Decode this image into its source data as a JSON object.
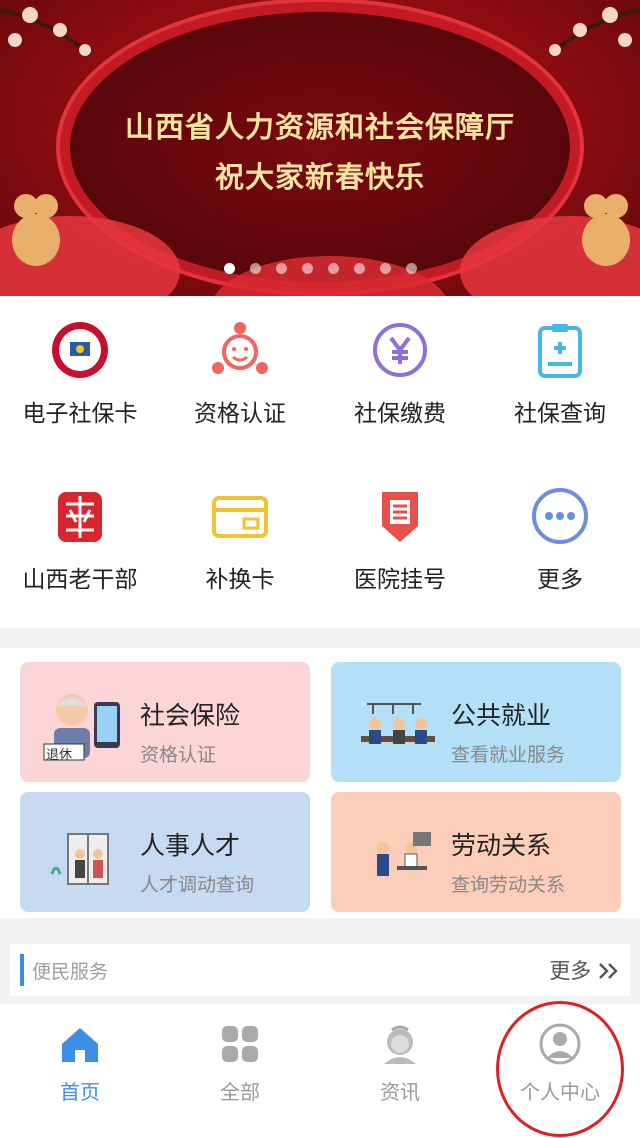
{
  "banner": {
    "line1": "山西省人力资源和社会保障厅",
    "line2": "祝大家新春快乐",
    "dot_count": 8,
    "active_dot": 0
  },
  "grid": [
    {
      "label": "电子社保卡",
      "icon": "social-security-card-icon"
    },
    {
      "label": "资格认证",
      "icon": "face-verification-icon"
    },
    {
      "label": "社保缴费",
      "icon": "yuan-payment-icon"
    },
    {
      "label": "社保查询",
      "icon": "clipboard-query-icon"
    },
    {
      "label": "山西老干部",
      "icon": "veteran-cadre-icon"
    },
    {
      "label": "补换卡",
      "icon": "card-replace-icon"
    },
    {
      "label": "医院挂号",
      "icon": "hospital-register-icon"
    },
    {
      "label": "更多",
      "icon": "more-dots-icon"
    }
  ],
  "cards": [
    {
      "title": "社会保险",
      "subtitle": "资格认证",
      "tag": "退休",
      "bg": "#fcd5d9"
    },
    {
      "title": "公共就业",
      "subtitle": "查看就业服务",
      "bg": "#b3e0f7"
    },
    {
      "title": "人事人才",
      "subtitle": "人才调动查询",
      "bg": "#c6dbf2"
    },
    {
      "title": "劳动关系",
      "subtitle": "查询劳动关系",
      "bg": "#fccdb8"
    }
  ],
  "service": {
    "label": "便民服务",
    "more": "更多"
  },
  "tabs": [
    {
      "label": "首页",
      "icon": "home-icon",
      "active": true
    },
    {
      "label": "全部",
      "icon": "grid-icon",
      "active": false
    },
    {
      "label": "资讯",
      "icon": "news-person-icon",
      "active": false
    },
    {
      "label": "个人中心",
      "icon": "user-icon",
      "active": false
    }
  ],
  "colors": {
    "accent": "#3d8ee6",
    "banner_red": "#8c0c12",
    "gold_text": "#f9e3a0"
  }
}
